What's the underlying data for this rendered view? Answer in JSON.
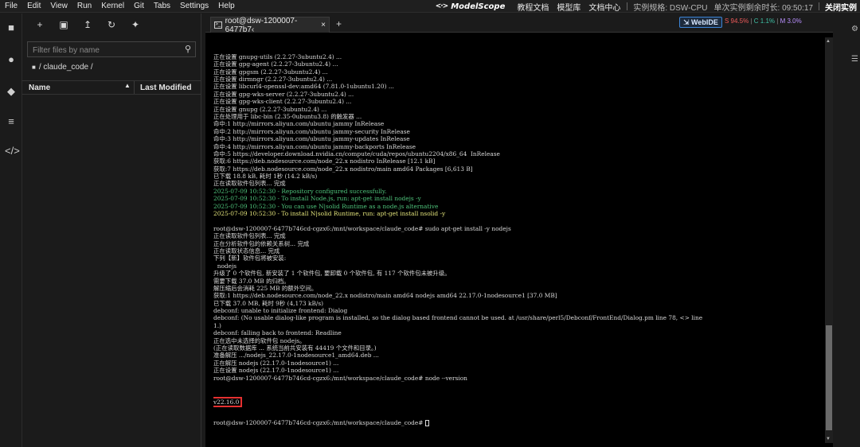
{
  "menubar": {
    "items": [
      "File",
      "Edit",
      "View",
      "Run",
      "Kernel",
      "Git",
      "Tabs",
      "Settings",
      "Help"
    ],
    "brand": "ModelScope",
    "links": [
      "教程文档",
      "模型库",
      "文档中心"
    ],
    "spec": "实例规格: DSW-CPU",
    "remaining": "单次实例剩余时长: 09:50:17",
    "close": "关闭实例"
  },
  "filebrowser": {
    "filter_placeholder": "Filter files by name",
    "breadcrumb": "/ claude_code /",
    "col_name": "Name",
    "col_modified": "Last Modified"
  },
  "terminal_tab": {
    "title": "root@dsw-1200007-6477b7‹",
    "close": "×",
    "new_tab": "+",
    "webide_label": "WebIDE",
    "metric_s": "S 94.5%",
    "metric_c": "C 1.1%",
    "metric_m": "M 3.0%"
  },
  "terminal": {
    "lines": [
      {
        "text": "正在设置 gnupg-utils (2.2.27-3ubuntu2.4) ...",
        "color": ""
      },
      {
        "text": "正在设置 gpg-agent (2.2.27-3ubuntu2.4) ...",
        "color": ""
      },
      {
        "text": "正在设置 gpgsm (2.2.27-3ubuntu2.4) ...",
        "color": ""
      },
      {
        "text": "正在设置 dirmngr (2.2.27-3ubuntu2.4) ...",
        "color": ""
      },
      {
        "text": "正在设置 libcurl4-openssl-dev:amd64 (7.81.0-1ubuntu1.20) ...",
        "color": ""
      },
      {
        "text": "正在设置 gpg-wks-server (2.2.27-3ubuntu2.4) ...",
        "color": ""
      },
      {
        "text": "正在设置 gpg-wks-client (2.2.27-3ubuntu2.4) ...",
        "color": ""
      },
      {
        "text": "正在设置 gnupg (2.2.27-3ubuntu2.4) ...",
        "color": ""
      },
      {
        "text": "正在处理用于 libc-bin (2.35-0ubuntu3.8) 的触发器 ...",
        "color": ""
      },
      {
        "text": "命中:1 http://mirrors.aliyun.com/ubuntu jammy InRelease",
        "color": ""
      },
      {
        "text": "命中:2 http://mirrors.aliyun.com/ubuntu jammy-security InRelease",
        "color": ""
      },
      {
        "text": "命中:3 http://mirrors.aliyun.com/ubuntu jammy-updates InRelease",
        "color": ""
      },
      {
        "text": "命中:4 http://mirrors.aliyun.com/ubuntu jammy-backports InRelease",
        "color": ""
      },
      {
        "text": "命中:5 https://developer.download.nvidia.cn/compute/cuda/repos/ubuntu2204/x86_64  InRelease",
        "color": ""
      },
      {
        "text": "获取:6 https://deb.nodesource.com/node_22.x nodistro InRelease [12.1 kB]",
        "color": ""
      },
      {
        "text": "获取:7 https://deb.nodesource.com/node_22.x nodistro/main amd64 Packages [6,613 B]",
        "color": ""
      },
      {
        "text": "已下载 18.8 kB, 耗时 1秒 (14.2 kB/s)",
        "color": ""
      },
      {
        "text": "正在读取软件包列表... 完成",
        "color": ""
      },
      {
        "text": "2025-07-09 10:52:30 - Repository configured successfully.",
        "color": "green"
      },
      {
        "text": "2025-07-09 10:52:30 - To install Node.js, run: apt-get install nodejs -y",
        "color": "green"
      },
      {
        "text": "2025-07-09 10:52:30 - You can use N|solid Runtime as a node.js alternative",
        "color": "green"
      },
      {
        "text": "2025-07-09 10:52:30 - To install N|solid Runtime, run: apt-get install nsolid -y",
        "color": "yellow"
      },
      {
        "text": "",
        "color": ""
      },
      {
        "text": "root@dsw-1200007-6477b746cd-cgzx6:/mnt/workspace/claude_code# sudo apt-get install -y nodejs",
        "color": ""
      },
      {
        "text": "正在读取软件包列表... 完成",
        "color": ""
      },
      {
        "text": "正在分析软件包的依赖关系树... 完成",
        "color": ""
      },
      {
        "text": "正在读取状态信息... 完成",
        "color": ""
      },
      {
        "text": "下列【新】软件包将被安装:",
        "color": ""
      },
      {
        "text": "  nodejs",
        "color": ""
      },
      {
        "text": "升级了 0 个软件包, 新安装了 1 个软件包, 要卸载 0 个软件包, 有 117 个软件包未被升级。",
        "color": ""
      },
      {
        "text": "需要下载 37.0 MB 的归档。",
        "color": ""
      },
      {
        "text": "解压缩后会消耗 225 MB 的额外空间。",
        "color": ""
      },
      {
        "text": "获取:1 https://deb.nodesource.com/node_22.x nodistro/main amd64 nodejs amd64 22.17.0-1nodesource1 [37.0 MB]",
        "color": ""
      },
      {
        "text": "已下载 37.0 MB, 耗时 9秒 (4,173 kB/s)",
        "color": ""
      },
      {
        "text": "debconf: unable to initialize frontend: Dialog",
        "color": ""
      },
      {
        "text": "debconf: (No usable dialog-like program is installed, so the dialog based frontend cannot be used. at /usr/share/perl5/Debconf/FrontEnd/Dialog.pm line 78, <> line",
        "color": ""
      },
      {
        "text": "1.)",
        "color": ""
      },
      {
        "text": "debconf: falling back to frontend: Readline",
        "color": ""
      },
      {
        "text": "正在选中未选择的软件包 nodejs。",
        "color": ""
      },
      {
        "text": "(正在读取数据库 ... 系统当前共安装有 44419 个文件和目录。)",
        "color": ""
      },
      {
        "text": "准备解压 .../nodejs_22.17.0-1nodesource1_amd64.deb ...",
        "color": ""
      },
      {
        "text": "正在解压 nodejs (22.17.0-1nodesource1) ...",
        "color": ""
      },
      {
        "text": "正在设置 nodejs (22.17.0-1nodesource1) ...",
        "color": ""
      },
      {
        "text": "root@dsw-1200007-6477b746cd-cgzx6:/mnt/workspace/claude_code# node --version",
        "color": ""
      }
    ],
    "version_output": "v22.16.0",
    "final_prompt": "root@dsw-1200007-6477b746cd-cgzx6:/mnt/workspace/claude_code# "
  },
  "colors": {
    "green": "#4ec27a",
    "yellow": "#e2e37a",
    "highlight": "#e53030",
    "webide_border": "#3d84d6"
  },
  "icons": {
    "leftbar": [
      "folder-icon",
      "running-icon",
      "git-icon",
      "toc-icon",
      "code-icon"
    ],
    "toolbar": [
      "new-launcher-icon",
      "new-folder-icon",
      "upload-icon",
      "refresh-icon",
      "git-clone-icon"
    ]
  }
}
